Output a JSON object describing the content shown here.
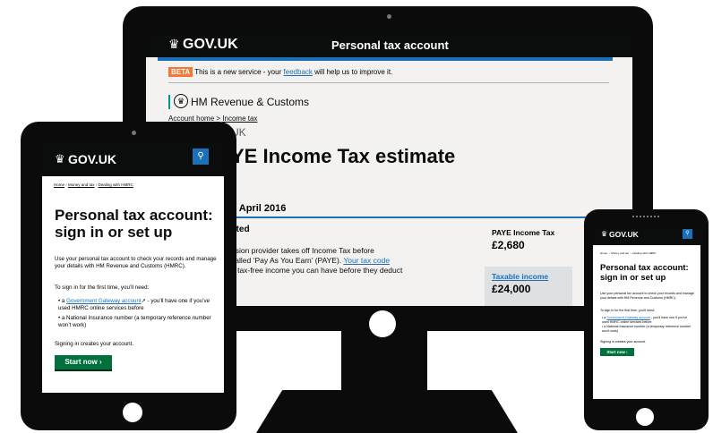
{
  "desktop": {
    "header_logo": "GOV.UK",
    "header_title": "Personal tax account",
    "beta_tag": "BETA",
    "beta_text_1": "This is a new service - your",
    "beta_link": "feedback",
    "beta_text_2": "will help us to improve it.",
    "dept": "HM Revenue & Customs",
    "breadcrumb_home": "Account home",
    "breadcrumb_sep": ">",
    "breadcrumb_current": "Income tax",
    "caption": "UK",
    "heading": "YE Income Tax estimate",
    "date_heading": "5 April 2016",
    "section_heading": "cted",
    "body_1": "nsion provider takes off Income Tax before",
    "body_2a": "called ‘Pay As You Earn’ (PAYE).",
    "body_2_link": "Your tax code",
    "body_3": "n tax-free income you can have before they deduct",
    "paye_label": "PAYE Income Tax",
    "paye_value": "£2,680",
    "taxable_label": "Taxable income",
    "taxable_value": "£24,000"
  },
  "tablet": {
    "logo": "GOV.UK",
    "search_icon": "search-icon",
    "crumb_1": "Home",
    "crumb_2": "Money and tax",
    "crumb_3": "Dealing with HMRC",
    "heading": "Personal tax account: sign in or set up",
    "intro": "Use your personal tax account to check your records and manage your details with HM Revenue and Customs (HMRC).",
    "first_time": "To sign in for the first time, you’ll need:",
    "bullet_1_link": "Government Gateway account",
    "bullet_1_rest": " - you’ll have one if you’ve used HMRC online services before",
    "bullet_2": "a National Insurance number (a temporary reference number won’t work)",
    "bullet_prefix": "a ",
    "signing": "Signing in creates your account.",
    "button": "Start now"
  },
  "phone": {
    "logo": "GOV.UK",
    "crumbs": "Home  ›  Money and tax  ›  Dealing with HMRC",
    "heading": "Personal tax account: sign in or set up",
    "intro": "Use your personal tax account to check your records and manage your details with HM Revenue and Customs (HMRC).",
    "first_time": "To sign in for the first time, you’ll need:",
    "bullet_1_link": "Government Gateway account",
    "bullet_1_rest": " - you’ll have one if you’ve used HMRC online services before",
    "bullet_2": "a National Insurance number (a temporary reference number won’t work)",
    "signing": "Signing in creates your account.",
    "button": "Start now"
  },
  "colors": {
    "govuk_black": "#0b0c0c",
    "link_blue": "#1d70b8",
    "beta_orange": "#f47738",
    "button_green": "#00703c",
    "hmrc_green": "#009390"
  }
}
